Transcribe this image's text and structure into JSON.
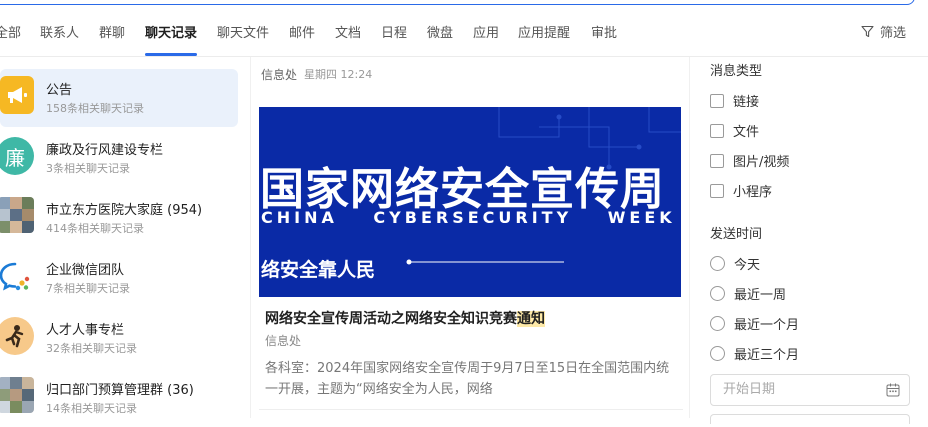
{
  "tabs": [
    {
      "label": "全部"
    },
    {
      "label": "联系人"
    },
    {
      "label": "群聊"
    },
    {
      "label": "聊天记录"
    },
    {
      "label": "聊天文件"
    },
    {
      "label": "邮件"
    },
    {
      "label": "文档"
    },
    {
      "label": "日程"
    },
    {
      "label": "微盘"
    },
    {
      "label": "应用"
    },
    {
      "label": "应用提醒"
    },
    {
      "label": "审批"
    }
  ],
  "active_tab": "聊天记录",
  "filter_label": "筛选",
  "results": [
    {
      "title": "公告",
      "subtitle": "158条相关聊天记录",
      "avatar": "megaphone-icon",
      "color": "#f6b823"
    },
    {
      "title": "廉政及行风建设专栏",
      "subtitle": "3条相关聊天记录",
      "avatar_text": "廉",
      "color": "#3fb8a6"
    },
    {
      "title": "市立东方医院大家庭 (954)",
      "subtitle": "414条相关聊天记录",
      "avatar": "group-photo"
    },
    {
      "title": "企业微信团队",
      "subtitle": "7条相关聊天记录",
      "avatar": "wecom-icon"
    },
    {
      "title": "人才人事专栏",
      "subtitle": "32条相关聊天记录",
      "avatar": "runner-icon",
      "color": "#f0a343"
    },
    {
      "title": "归口部门预算管理群 (36)",
      "subtitle": "14条相关聊天记录",
      "avatar": "group-photo"
    }
  ],
  "message": {
    "sender": "信息处",
    "time": "星期四 12:24",
    "banner_title": "国家网络安全宣传周",
    "banner_english": "CHINA CYBERSECURITY WEEK",
    "banner_slogan": "络安全靠人民",
    "article_title_prefix": "网络安全宣传周活动之网络安全知识竞赛",
    "article_title_highlight": "通知",
    "article_source": "信息处",
    "article_desc": "各科室：2024年国家网络安全宣传周于9月7日至15日在全国范围内统一开展，主题为“网络安全为人民，网络"
  },
  "filters": {
    "type_title": "消息类型",
    "types": [
      "链接",
      "文件",
      "图片/视频",
      "小程序"
    ],
    "time_title": "发送时间",
    "times": [
      "今天",
      "最近一周",
      "最近一个月",
      "最近三个月"
    ],
    "start_date_placeholder": "开始日期"
  }
}
